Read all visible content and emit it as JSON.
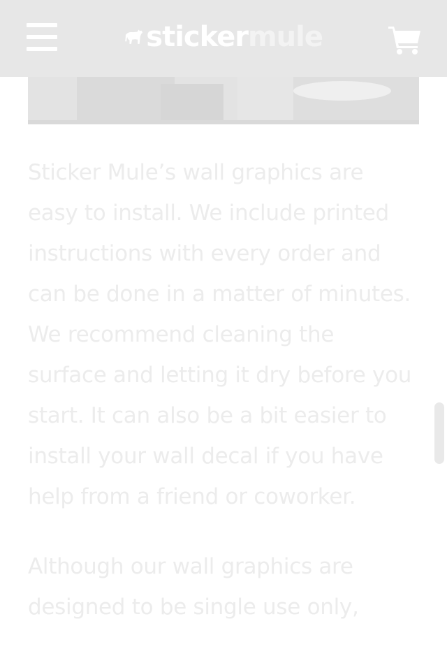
{
  "header": {
    "logo_text_primary": "sticker",
    "logo_text_secondary": "mule",
    "menu_icon": "hamburger-menu-icon",
    "cart_icon": "shopping-cart-icon",
    "background_color": "#e7e7e7"
  },
  "main": {
    "paragraphs": [
      "Sticker Mule’s wall graphics are easy to install. We include printed instructions with every order and can be done in a matter of minutes. We recommend cleaning the surface and letting it dry before you start. It can also be a bit easier to install your wall decal if you have help from a friend or coworker.",
      "Although our wall graphics are designed to be single use only,"
    ],
    "text_color": "#ececec"
  }
}
